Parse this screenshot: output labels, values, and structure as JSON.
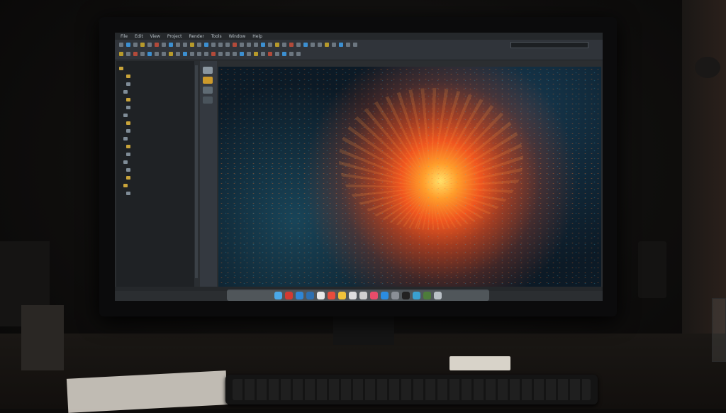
{
  "window": {
    "menu_items": [
      "File",
      "Edit",
      "View",
      "Project",
      "Render",
      "Tools",
      "Window",
      "Help"
    ],
    "title": "",
    "status": ""
  },
  "toolbar": {
    "search_placeholder": ""
  },
  "sidebar": {
    "items": [
      {
        "label": "",
        "icon": "folder-icon"
      },
      {
        "label": "",
        "icon": "folder-icon"
      },
      {
        "label": "",
        "icon": "document-icon"
      },
      {
        "label": "",
        "icon": "document-icon"
      },
      {
        "label": "",
        "icon": "folder-icon"
      },
      {
        "label": "",
        "icon": "document-icon"
      },
      {
        "label": "",
        "icon": "document-icon"
      },
      {
        "label": "",
        "icon": "folder-icon"
      },
      {
        "label": "",
        "icon": "document-icon"
      },
      {
        "label": "",
        "icon": "document-icon"
      },
      {
        "label": "",
        "icon": "folder-icon"
      },
      {
        "label": "",
        "icon": "document-icon"
      },
      {
        "label": "",
        "icon": "document-icon"
      },
      {
        "label": "",
        "icon": "document-icon"
      },
      {
        "label": "",
        "icon": "folder-icon"
      },
      {
        "label": "",
        "icon": "folder-icon"
      },
      {
        "label": "",
        "icon": "document-icon"
      }
    ]
  },
  "code_lines": [
    {
      "text": "",
      "color": "#e0533a"
    },
    {
      "text": "",
      "color": "#7fd35a"
    },
    {
      "text": "",
      "color": "#e0533a"
    },
    {
      "text": "",
      "color": "#7fd35a"
    },
    {
      "text": "",
      "color": "#e0533a"
    },
    {
      "text": "",
      "color": "#7fd35a"
    },
    {
      "text": "",
      "color": "#e0533a"
    },
    {
      "text": "",
      "color": "#7fd35a"
    },
    {
      "text": "",
      "color": "#e0533a"
    },
    {
      "text": "",
      "color": "#7fd35a"
    }
  ],
  "dock_apps": [
    {
      "name": "finder-icon",
      "color": "#4aa8e8"
    },
    {
      "name": "launchpad-icon",
      "color": "#d23a32"
    },
    {
      "name": "safari-icon",
      "color": "#2f86d6"
    },
    {
      "name": "mail-icon",
      "color": "#2d6fb0"
    },
    {
      "name": "photos-icon",
      "color": "#e8e8e8"
    },
    {
      "name": "calendar-icon",
      "color": "#e74c3c"
    },
    {
      "name": "notes-icon",
      "color": "#f0c23a"
    },
    {
      "name": "reminders-icon",
      "color": "#dddddd"
    },
    {
      "name": "preview-icon",
      "color": "#cfcfcf"
    },
    {
      "name": "music-icon",
      "color": "#e84c6a"
    },
    {
      "name": "appstore-icon",
      "color": "#2b8ce0"
    },
    {
      "name": "settings-icon",
      "color": "#8a8f96"
    },
    {
      "name": "terminal-icon",
      "color": "#222222"
    },
    {
      "name": "globe-icon",
      "color": "#3aa0d0"
    },
    {
      "name": "editor-icon",
      "color": "#4d7c3a"
    },
    {
      "name": "trash-icon",
      "color": "#b9c0c6"
    }
  ]
}
